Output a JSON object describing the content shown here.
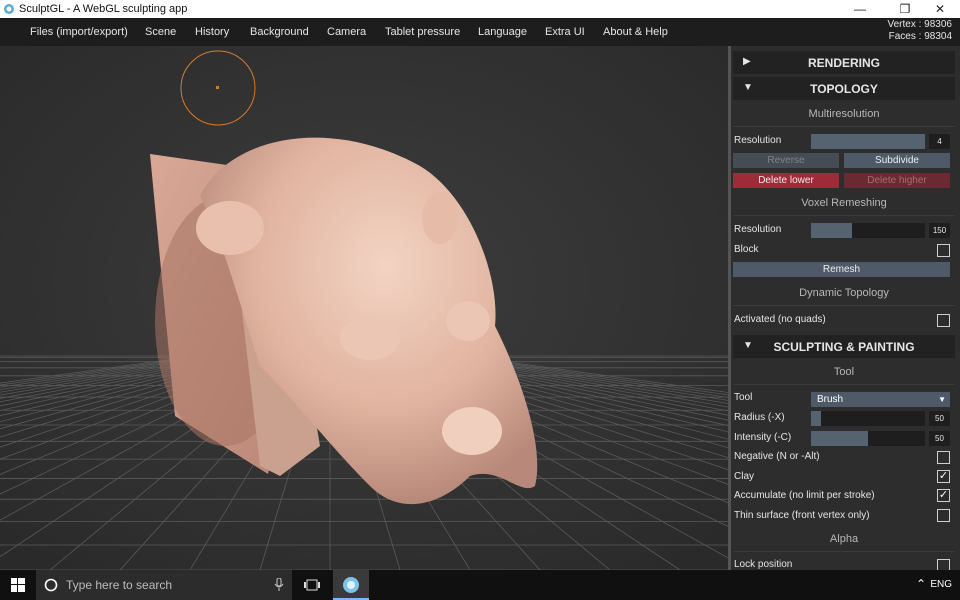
{
  "window": {
    "title": "SculptGL - A WebGL sculpting app",
    "controls": {
      "minimize": "—",
      "restore": "❐",
      "close": "✕"
    }
  },
  "menu": {
    "items": [
      "Files (import/export)",
      "Scene",
      "History",
      "Background",
      "Camera",
      "Tablet pressure",
      "Language",
      "Extra UI",
      "About & Help"
    ]
  },
  "stats": {
    "vertex": "Vertex : 98306",
    "faces": "Faces : 98304"
  },
  "panel": {
    "rendering": {
      "label": "RENDERING",
      "arrow": "▶"
    },
    "topology": {
      "label": "TOPOLOGY",
      "arrow": "▼",
      "multires": {
        "title": "Multiresolution",
        "resolution_label": "Resolution",
        "resolution_value": "4",
        "resolution_fill": 1.0,
        "reverse": "Reverse",
        "subdivide": "Subdivide",
        "delete_lower": "Delete lower",
        "delete_higher": "Delete higher"
      },
      "voxel": {
        "title": "Voxel Remeshing",
        "resolution_label": "Resolution",
        "resolution_value": "150",
        "resolution_fill": 0.36,
        "block_label": "Block",
        "remesh": "Remesh"
      },
      "dynamic": {
        "title": "Dynamic Topology",
        "activated_label": "Activated (no quads)"
      }
    },
    "sculpting": {
      "label": "SCULPTING & PAINTING",
      "arrow": "▼",
      "tool_title": "Tool",
      "tool_label": "Tool",
      "tool_value": "Brush",
      "radius_label": "Radius (-X)",
      "radius_value": "50",
      "radius_fill": 0.09,
      "intensity_label": "Intensity (-C)",
      "intensity_value": "50",
      "intensity_fill": 0.5,
      "negative_label": "Negative (N or -Alt)",
      "negative_checked": false,
      "clay_label": "Clay",
      "clay_checked": true,
      "accumulate_label": "Accumulate (no limit per stroke)",
      "accumulate_checked": true,
      "thin_label": "Thin surface (front vertex only)",
      "thin_checked": false,
      "alpha_title": "Alpha",
      "lock_label": "Lock position"
    },
    "block_checked": false,
    "activated_checked": false
  },
  "taskbar": {
    "search_placeholder": "Type here to search",
    "language": "ENG",
    "tray_arrow": "⌃"
  },
  "colors": {
    "accent": "#4f5a68",
    "danger": "#a02b38",
    "model": "#e2b6a3",
    "cursor": "#d77a2a"
  }
}
